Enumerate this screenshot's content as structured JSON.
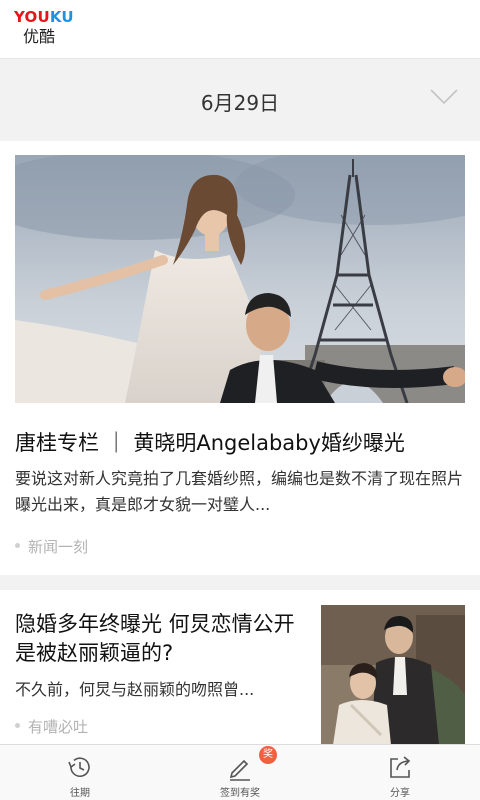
{
  "header": {
    "logo_text_you": "YOU",
    "logo_text_ku": "KU",
    "logo_cn": "优酷"
  },
  "date_bar": {
    "date": "6月29日",
    "toggle_icon": "chevron-down-icon"
  },
  "articles": [
    {
      "title": "唐桂专栏 ｜ 黄晓明Angelababy婚纱曝光",
      "summary": "要说这对新人究竟拍了几套婚纱照，编编也是数不清了现在照片曝光出来，真是郎才女貌一对璧人...",
      "source": "新闻一刻"
    },
    {
      "title": "隐婚多年终曝光 何炅恋情公开是被赵丽颖逼的?",
      "summary": "不久前，何炅与赵丽颖的吻照曾...",
      "source": "有嘈必吐"
    }
  ],
  "tabbar": {
    "tabs": [
      {
        "label": "往期",
        "icon": "history-clock-icon"
      },
      {
        "label": "签到有奖",
        "icon": "pencil-checkin-icon"
      },
      {
        "label": "分享",
        "icon": "share-icon"
      }
    ],
    "badge": "奖"
  },
  "colors": {
    "brand_red": "#e8141b",
    "brand_blue": "#1b93e0",
    "badge": "#f35f41",
    "background_gray": "#f2f2f2"
  }
}
